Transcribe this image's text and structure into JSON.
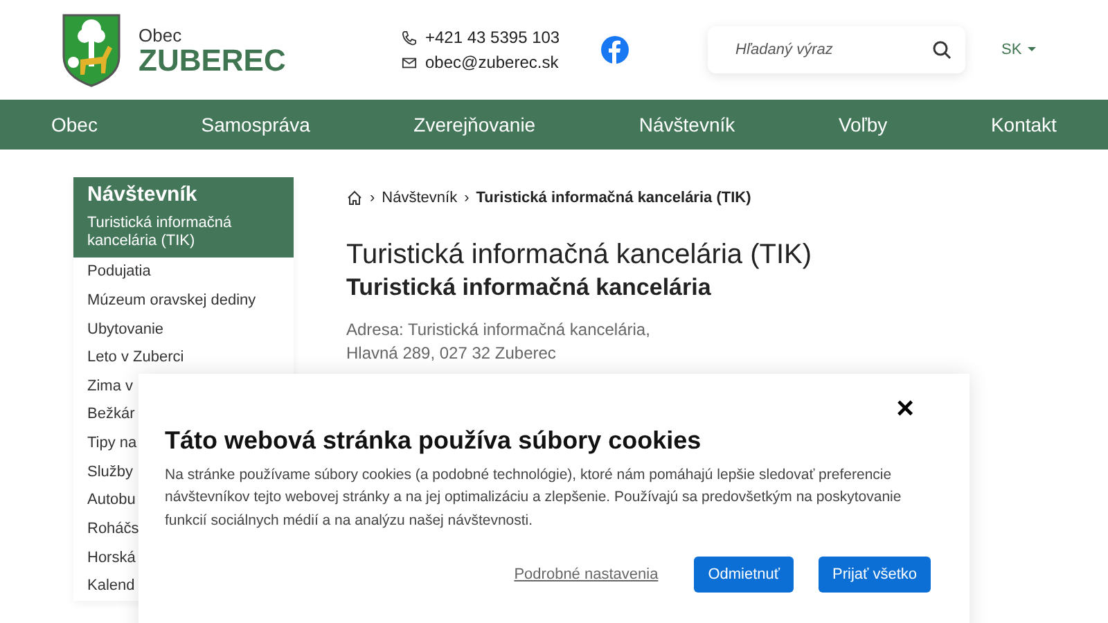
{
  "header": {
    "logo_small": "Obec",
    "logo_name": "ZUBEREC",
    "phone": "+421 43 5395 103",
    "email": "obec@zuberec.sk",
    "search": {
      "placeholder": "Hľadaný výraz"
    },
    "language": "SK"
  },
  "nav": [
    {
      "label": "Obec"
    },
    {
      "label": "Samospráva"
    },
    {
      "label": "Zverejňovanie"
    },
    {
      "label": "Návštevník"
    },
    {
      "label": "Voľby"
    },
    {
      "label": "Kontakt"
    }
  ],
  "sidebar": {
    "title": "Návštevník",
    "items": [
      {
        "label": "Turistická informačná kancelária (TIK)",
        "selected": true
      },
      {
        "label": "Podujatia",
        "selected": false
      },
      {
        "label": "Múzeum oravskej dediny",
        "selected": false
      },
      {
        "label": "Ubytovanie",
        "selected": false
      },
      {
        "label": "Leto v Zuberci",
        "selected": false
      },
      {
        "label": "Zima v",
        "selected": false
      },
      {
        "label": "Bežkár",
        "selected": false
      },
      {
        "label": "Tipy na",
        "selected": false
      },
      {
        "label": "Služby",
        "selected": false
      },
      {
        "label": "Autobu",
        "selected": false
      },
      {
        "label": "Roháčs",
        "selected": false
      },
      {
        "label": "Horská",
        "selected": false
      },
      {
        "label": "Kalend",
        "selected": false
      }
    ]
  },
  "breadcrumb": {
    "separator": "›",
    "items": [
      "Návštevník",
      "Turistická informačná kancelária (TIK)"
    ]
  },
  "content": {
    "title": "Turistická informačná kancelária (TIK)",
    "subtitle": "Turistická informačná kancelária",
    "address": [
      "Adresa: Turistická informačná kancelária,",
      "Hlavná 289, 027 32 Zuberec"
    ]
  },
  "cookie_dialog": {
    "close": "×",
    "title": "Táto webová stránka používa súbory cookies",
    "text": "Na stránke používame súbory cookies (a podobné technológie), ktoré nám pomáhajú lepšie sledovať preferencie návštevníkov tejto webovej stránky a na jej optimalizáciu a zlepšenie. Používajú sa predovšetkým na poskytovanie funkcií sociálnych médií a na analýzu našej návštevnosti.",
    "settings_link": "Podrobné nastavenia",
    "buttons": [
      "Odmietnuť",
      "Prijať všetko"
    ]
  }
}
